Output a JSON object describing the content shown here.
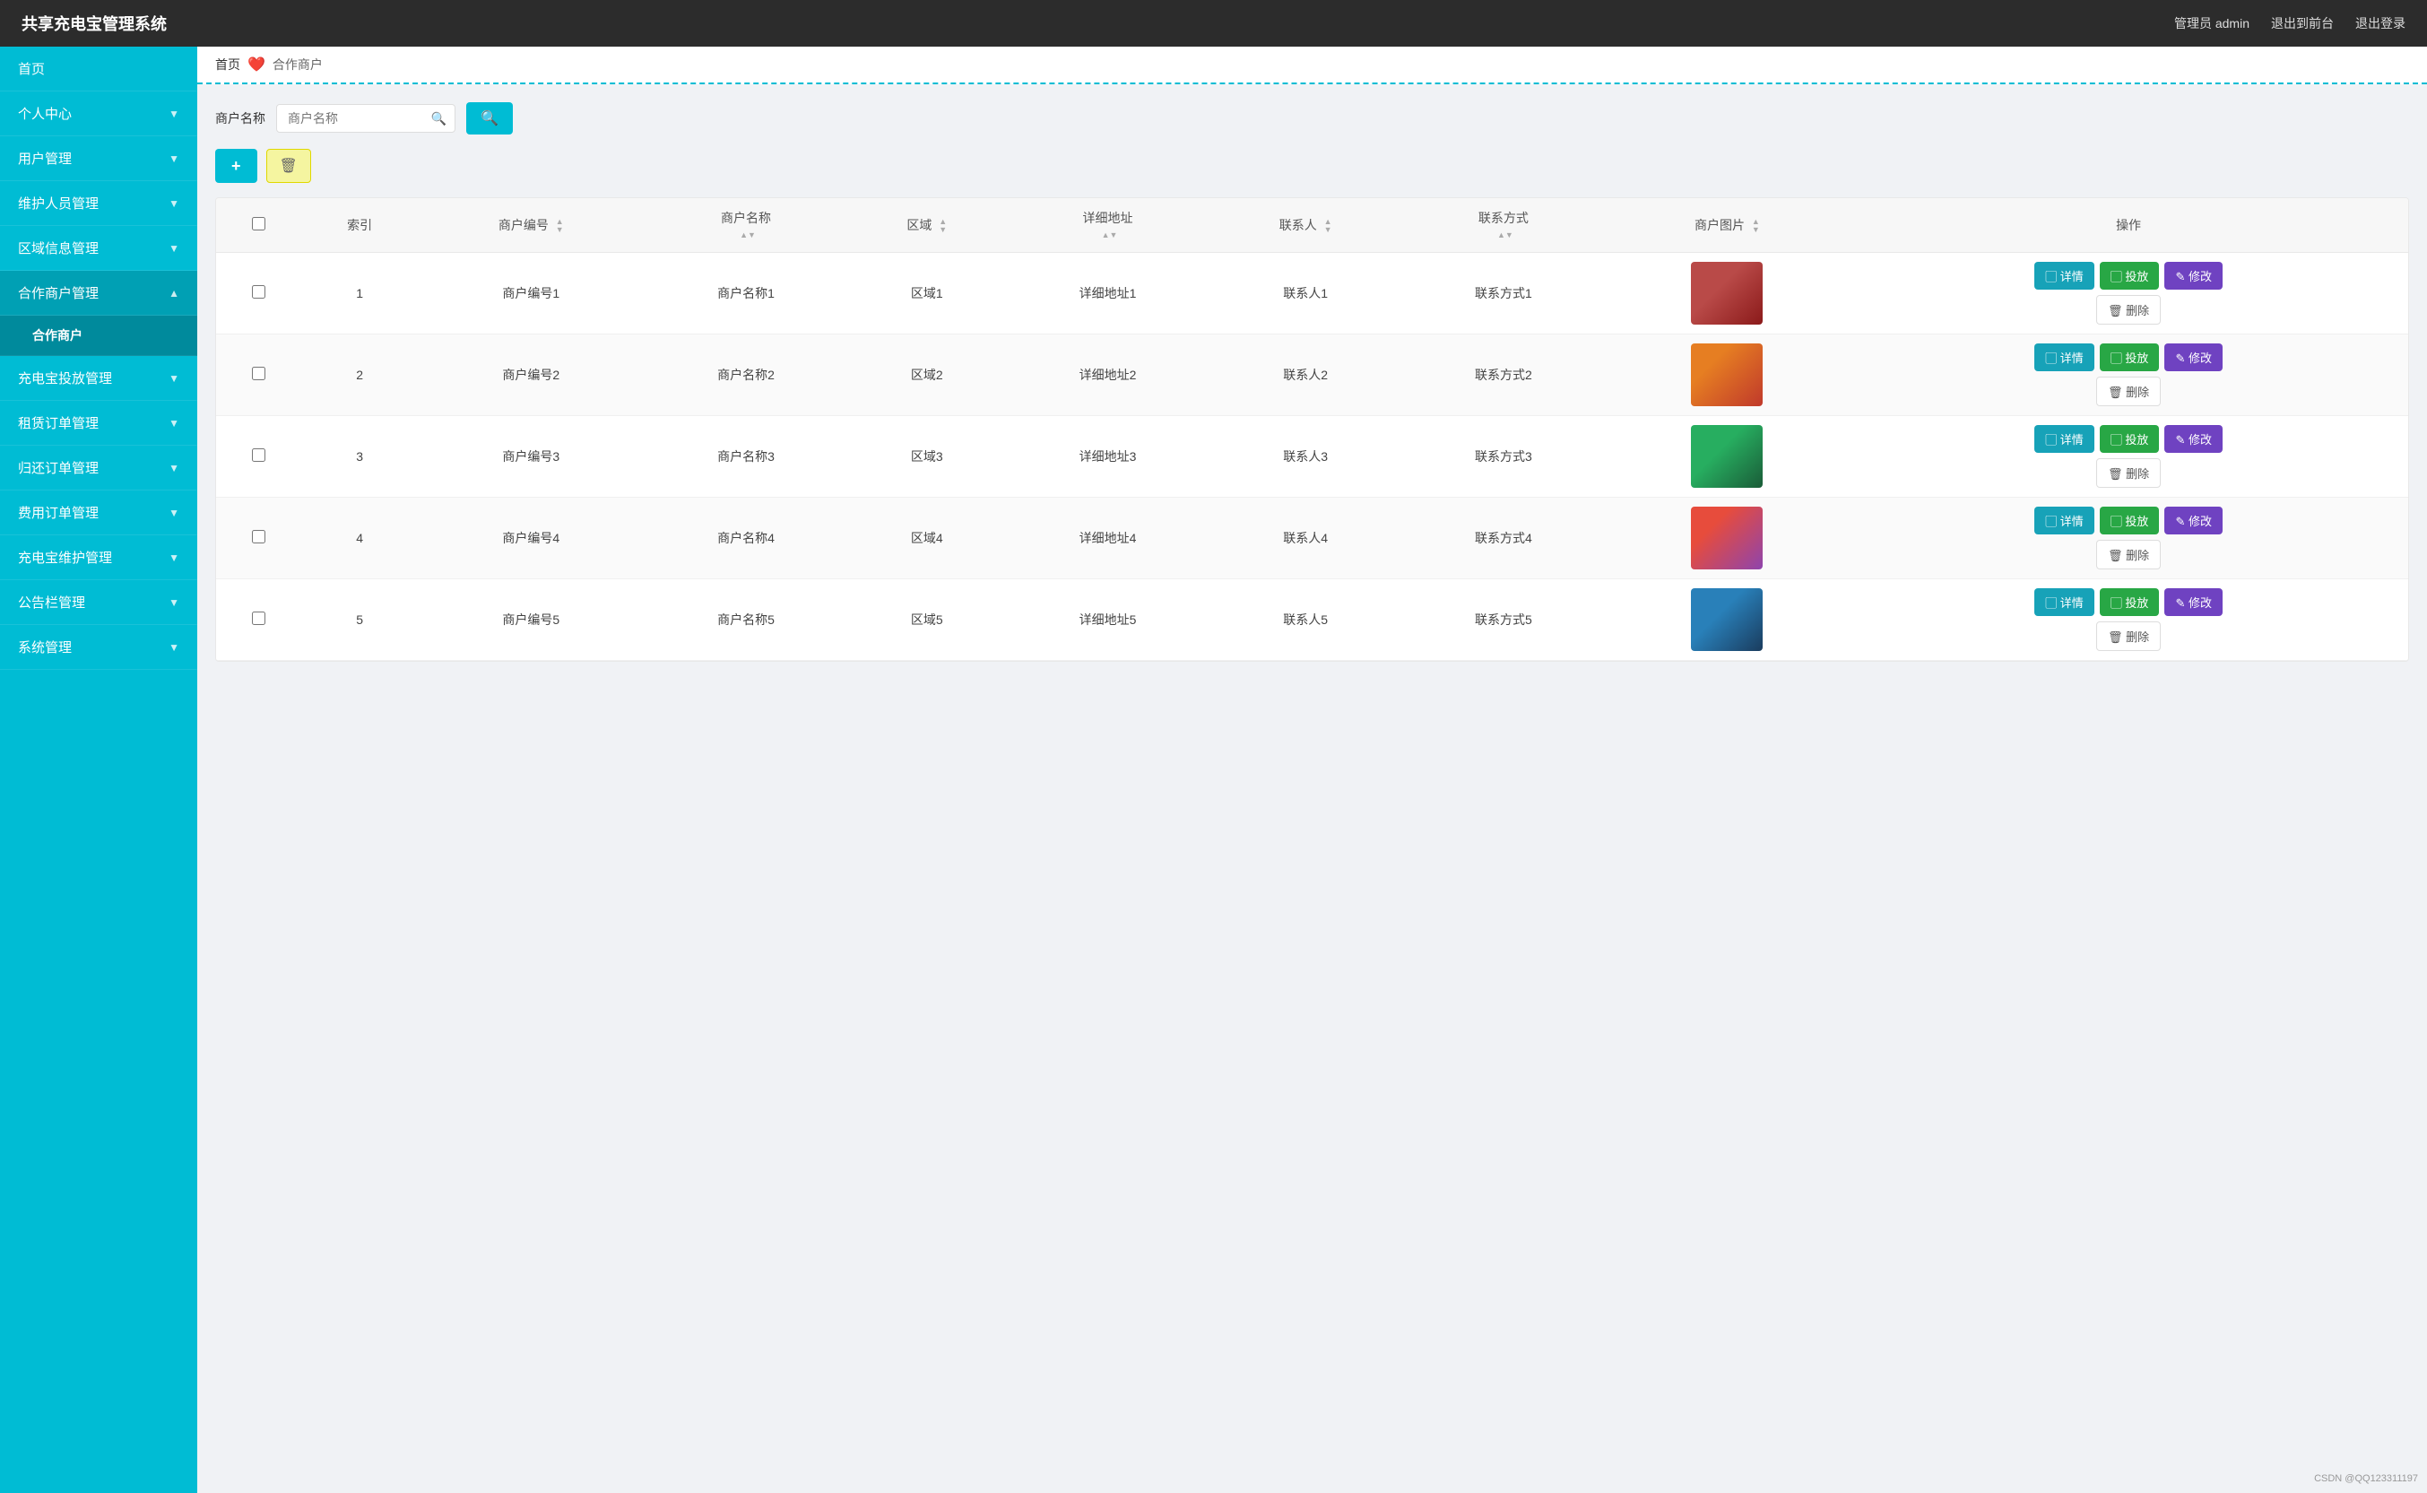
{
  "header": {
    "title": "共享充电宝管理系统",
    "user_label": "管理员 admin",
    "btn_frontend": "退出到前台",
    "btn_logout": "退出登录"
  },
  "sidebar": {
    "items": [
      {
        "id": "home",
        "label": "首页",
        "has_sub": false,
        "active": false
      },
      {
        "id": "personal",
        "label": "个人中心",
        "has_sub": true,
        "active": false
      },
      {
        "id": "user-mgmt",
        "label": "用户管理",
        "has_sub": true,
        "active": false
      },
      {
        "id": "maintenance",
        "label": "维护人员管理",
        "has_sub": true,
        "active": false
      },
      {
        "id": "region",
        "label": "区域信息管理",
        "has_sub": true,
        "active": false
      },
      {
        "id": "merchant",
        "label": "合作商户管理",
        "has_sub": true,
        "active": true
      },
      {
        "id": "merchant-sub",
        "label": "合作商户",
        "has_sub": false,
        "active": true,
        "is_sub": true
      },
      {
        "id": "charger-deploy",
        "label": "充电宝投放管理",
        "has_sub": true,
        "active": false
      },
      {
        "id": "rental-order",
        "label": "租赁订单管理",
        "has_sub": true,
        "active": false
      },
      {
        "id": "return-order",
        "label": "归还订单管理",
        "has_sub": true,
        "active": false
      },
      {
        "id": "fee-order",
        "label": "费用订单管理",
        "has_sub": true,
        "active": false
      },
      {
        "id": "charger-maintain",
        "label": "充电宝维护管理",
        "has_sub": true,
        "active": false
      },
      {
        "id": "notice",
        "label": "公告栏管理",
        "has_sub": true,
        "active": false
      },
      {
        "id": "system",
        "label": "系统管理",
        "has_sub": true,
        "active": false
      }
    ]
  },
  "breadcrumb": {
    "home": "首页",
    "separator": "❤",
    "current": "合作商户"
  },
  "search": {
    "label": "商户名称",
    "placeholder": "商户名称",
    "btn_icon": "🔍"
  },
  "toolbar": {
    "add_label": "+",
    "delete_label": "🗑"
  },
  "table": {
    "columns": [
      {
        "id": "checkbox",
        "label": ""
      },
      {
        "id": "index",
        "label": "索引"
      },
      {
        "id": "merchant_id",
        "label": "商户编号",
        "sortable": true
      },
      {
        "id": "merchant_name",
        "label": "商户名称",
        "sortable": true
      },
      {
        "id": "region",
        "label": "区域",
        "sortable": true
      },
      {
        "id": "address",
        "label": "详细地址",
        "sortable": true
      },
      {
        "id": "contact",
        "label": "联系人",
        "sortable": true
      },
      {
        "id": "contact_method",
        "label": "联系方式",
        "sortable": true
      },
      {
        "id": "image",
        "label": "商户图片",
        "sortable": true
      },
      {
        "id": "action",
        "label": "操作"
      }
    ],
    "rows": [
      {
        "index": 1,
        "merchant_id": "商户编号1",
        "merchant_name": "商户名称1",
        "region": "区域1",
        "address": "详细地址1",
        "contact": "联系人1",
        "contact_method": "联系方式1",
        "img_class": "img-1"
      },
      {
        "index": 2,
        "merchant_id": "商户编号2",
        "merchant_name": "商户名称2",
        "region": "区域2",
        "address": "详细地址2",
        "contact": "联系人2",
        "contact_method": "联系方式2",
        "img_class": "img-2"
      },
      {
        "index": 3,
        "merchant_id": "商户编号3",
        "merchant_name": "商户名称3",
        "region": "区域3",
        "address": "详细地址3",
        "contact": "联系人3",
        "contact_method": "联系方式3",
        "img_class": "img-3"
      },
      {
        "index": 4,
        "merchant_id": "商户编号4",
        "merchant_name": "商户名称4",
        "region": "区域4",
        "address": "详细地址4",
        "contact": "联系人4",
        "contact_method": "联系方式4",
        "img_class": "img-4"
      },
      {
        "index": 5,
        "merchant_id": "商户编号5",
        "merchant_name": "商户名称5",
        "region": "区域5",
        "address": "详细地址5",
        "contact": "联系人5",
        "contact_method": "联系方式5",
        "img_class": "img-5"
      }
    ],
    "action_buttons": {
      "detail": "详情",
      "deploy": "投放",
      "edit": "修改",
      "delete": "删除"
    }
  },
  "footer": {
    "text": "CSDN @QQ123311197"
  }
}
